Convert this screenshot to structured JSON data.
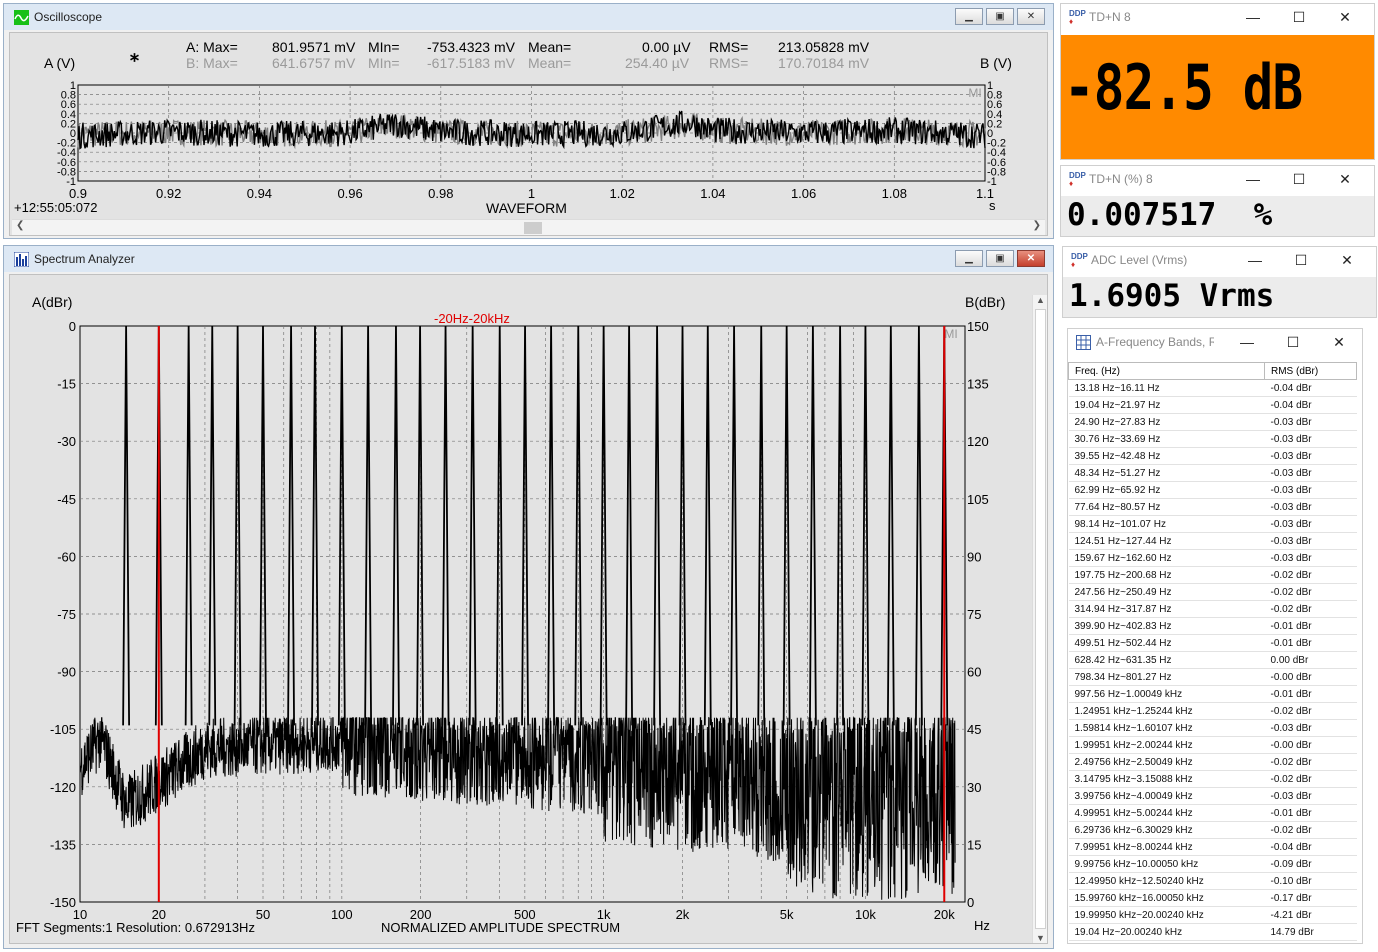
{
  "oscilloscope": {
    "title": "Oscilloscope",
    "a_label": "A (V)",
    "b_label": "B (V)",
    "a_stats": {
      "max_label": "A: Max=",
      "max": "801.9571 mV",
      "min_label": "MIn=",
      "min": "-753.4323 mV",
      "mean_label": "Mean=",
      "mean": "0.00  µV",
      "rms_label": "RMS=",
      "rms": "213.05828 mV"
    },
    "b_stats": {
      "max_label": "B: Max=",
      "max": "641.6757 mV",
      "min_label": "MIn=",
      "min": "-617.5183 mV",
      "mean_label": "Mean=",
      "mean": "254.40  µV",
      "rms_label": "RMS=",
      "rms": "170.70184 mV"
    },
    "y_ticks_left": [
      "1",
      "0.8",
      "0.6",
      "0.4",
      "0.2",
      "0",
      "-0.2",
      "-0.4",
      "-0.6",
      "-0.8",
      "-1"
    ],
    "y_ticks_right": [
      "1",
      "0.8",
      "0.6",
      "0.4",
      "0.2",
      "0",
      "-0.2",
      "-0.4",
      "-0.6",
      "-0.8",
      "-1"
    ],
    "x_ticks": [
      "0.9",
      "0.92",
      "0.94",
      "0.96",
      "0.98",
      "1",
      "1.02",
      "1.04",
      "1.06",
      "1.08",
      "1.1"
    ],
    "x_unit": "s",
    "timestamp": "+12:55:05:072",
    "xlabel": "WAVEFORM",
    "corner_badge": "MI"
  },
  "spectrum": {
    "title": "Spectrum Analyzer",
    "a_label": "A(dBr)",
    "b_label": "B(dBr)",
    "band_label": "-20Hz-20kHz",
    "y_left": [
      "0",
      "-15",
      "-30",
      "-45",
      "-60",
      "-75",
      "-90",
      "-105",
      "-120",
      "-135",
      "-150"
    ],
    "y_right": [
      "150",
      "135",
      "120",
      "105",
      "90",
      "75",
      "60",
      "45",
      "30",
      "15",
      "0"
    ],
    "x_ticks": [
      "10",
      "20",
      "50",
      "100",
      "200",
      "500",
      "1k",
      "2k",
      "5k",
      "10k",
      "20k"
    ],
    "x_unit": "Hz",
    "footer_left": "FFT Segments:1   Resolution: 0.672913Hz",
    "footer_center": "NORMALIZED AMPLITUDE SPECTRUM",
    "corner_badge": "MI"
  },
  "tdn_db": {
    "title": "TD+N  8",
    "value": "-82.5 dB",
    "bg": "#ff8a00"
  },
  "tdn_pct": {
    "title": "TD+N (%)  8",
    "value": "0.007517  %"
  },
  "adc": {
    "title": "ADC Level (Vrms)",
    "value": "1.6905 Vrms"
  },
  "bands": {
    "title": "A-Frequency Bands, R...",
    "col_freq": "Freq. (Hz)",
    "col_rms": "RMS (dBr)",
    "rows": [
      [
        "13.18 Hz~16.11 Hz",
        "-0.04 dBr"
      ],
      [
        "19.04 Hz~21.97 Hz",
        "-0.04 dBr"
      ],
      [
        "24.90 Hz~27.83 Hz",
        "-0.03 dBr"
      ],
      [
        "30.76 Hz~33.69 Hz",
        "-0.03 dBr"
      ],
      [
        "39.55 Hz~42.48 Hz",
        "-0.03 dBr"
      ],
      [
        "48.34 Hz~51.27 Hz",
        "-0.03 dBr"
      ],
      [
        "62.99 Hz~65.92 Hz",
        "-0.03 dBr"
      ],
      [
        "77.64 Hz~80.57 Hz",
        "-0.03 dBr"
      ],
      [
        "98.14 Hz~101.07 Hz",
        "-0.03 dBr"
      ],
      [
        "124.51 Hz~127.44 Hz",
        "-0.03 dBr"
      ],
      [
        "159.67 Hz~162.60 Hz",
        "-0.03 dBr"
      ],
      [
        "197.75 Hz~200.68 Hz",
        "-0.02 dBr"
      ],
      [
        "247.56 Hz~250.49 Hz",
        "-0.02 dBr"
      ],
      [
        "314.94 Hz~317.87 Hz",
        "-0.02 dBr"
      ],
      [
        "399.90 Hz~402.83 Hz",
        "-0.01 dBr"
      ],
      [
        "499.51 Hz~502.44 Hz",
        "-0.01 dBr"
      ],
      [
        "628.42 Hz~631.35 Hz",
        "0.00 dBr"
      ],
      [
        "798.34 Hz~801.27 Hz",
        "-0.00 dBr"
      ],
      [
        "997.56 Hz~1.00049 kHz",
        "-0.01 dBr"
      ],
      [
        "1.24951 kHz~1.25244 kHz",
        "-0.02 dBr"
      ],
      [
        "1.59814 kHz~1.60107 kHz",
        "-0.03 dBr"
      ],
      [
        "1.99951 kHz~2.00244 kHz",
        "-0.00 dBr"
      ],
      [
        "2.49756 kHz~2.50049 kHz",
        "-0.02 dBr"
      ],
      [
        "3.14795 kHz~3.15088 kHz",
        "-0.02 dBr"
      ],
      [
        "3.99756 kHz~4.00049 kHz",
        "-0.03 dBr"
      ],
      [
        "4.99951 kHz~5.00244 kHz",
        "-0.01 dBr"
      ],
      [
        "6.29736 kHz~6.30029 kHz",
        "-0.02 dBr"
      ],
      [
        "7.99951 kHz~8.00244 kHz",
        "-0.04 dBr"
      ],
      [
        "9.99756 kHz~10.00050 kHz",
        "-0.09 dBr"
      ],
      [
        "12.49950 kHz~12.50240 kHz",
        "-0.10 dBr"
      ],
      [
        "15.99760 kHz~16.00050 kHz",
        "-0.17 dBr"
      ],
      [
        "19.99950 kHz~20.00240 kHz",
        "-4.21 dBr"
      ],
      [
        "19.04 Hz~20.00240 kHz",
        "14.79 dBr"
      ]
    ]
  },
  "chart_data": [
    {
      "type": "line",
      "title": "WAVEFORM",
      "xlabel": "s",
      "ylabel": "A (V)",
      "xlim": [
        0.9,
        1.1
      ],
      "ylim": [
        -1,
        1
      ],
      "series": [
        {
          "name": "A",
          "color": "#000000",
          "x": [
            0.9,
            0.92,
            0.94,
            0.96,
            0.97,
            0.98,
            1.0,
            1.02,
            1.035,
            1.04,
            1.06,
            1.08,
            1.1
          ],
          "y": [
            -0.1,
            0.05,
            -0.05,
            0.0,
            0.35,
            0.05,
            -0.05,
            0.0,
            0.4,
            0.1,
            0.0,
            0.1,
            -0.1
          ]
        },
        {
          "name": "B",
          "color": "#808080",
          "x": [
            0.9,
            0.92,
            0.94,
            0.96,
            0.97,
            0.98,
            1.0,
            1.02,
            1.035,
            1.04,
            1.06,
            1.08,
            1.1
          ],
          "y": [
            -0.05,
            0.05,
            -0.05,
            0.0,
            0.3,
            0.05,
            -0.05,
            0.0,
            0.3,
            0.1,
            0.0,
            0.1,
            -0.05
          ]
        }
      ]
    },
    {
      "type": "line",
      "title": "NORMALIZED AMPLITUDE SPECTRUM",
      "xlabel": "Hz",
      "ylabel": "A(dBr)",
      "xscale": "log",
      "xlim": [
        10,
        24000
      ],
      "ylim": [
        -150,
        0
      ],
      "peaks_hz": [
        15,
        20,
        26,
        32,
        40,
        50,
        64,
        79,
        100,
        126,
        161,
        199,
        249,
        316,
        401,
        501,
        630,
        800,
        1000,
        1251,
        1600,
        2001,
        2499,
        3149,
        3999,
        5001,
        6299,
        8001,
        9999,
        12501,
        16001,
        20001
      ],
      "noise_floor": [
        [
          10,
          -115
        ],
        [
          12,
          -107
        ],
        [
          15,
          -125
        ],
        [
          30,
          -110
        ],
        [
          100,
          -108
        ],
        [
          500,
          -112
        ],
        [
          2000,
          -115
        ],
        [
          10000,
          -120
        ],
        [
          22000,
          -118
        ]
      ],
      "band_markers_hz": [
        20,
        20000
      ]
    }
  ]
}
